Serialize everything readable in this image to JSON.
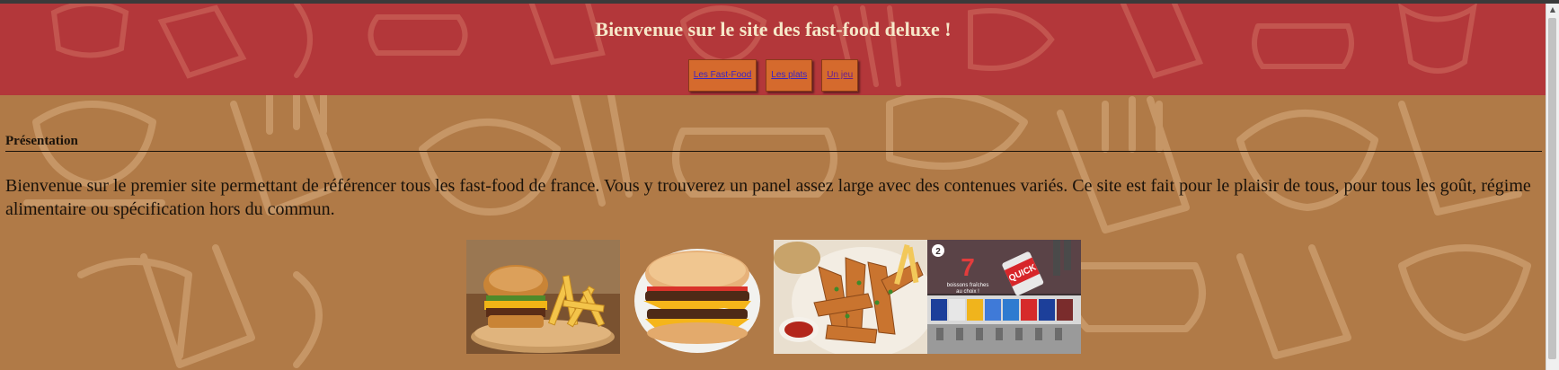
{
  "header": {
    "title": "Bienvenue sur le site des fast-food deluxe !",
    "nav": [
      {
        "label": "Les Fast-Food"
      },
      {
        "label": "Les plats"
      },
      {
        "label": "Un jeu"
      }
    ]
  },
  "main": {
    "section_title": "Présentation",
    "intro": "Bienvenue sur le premier site permettant de référencer tous les fast-food de france. Vous y trouverez un panel assez large avec des contenues variés. Ce site est fait pour le plaisir de tous, pour tous les goût, régime alimentaire ou spécification hors du commun.",
    "images": [
      {
        "name": "burger-and-fries-photo"
      },
      {
        "name": "double-cheeseburger-photo"
      },
      {
        "name": "potato-wedges-photo"
      },
      {
        "name": "soda-fountain-photo",
        "badge": "2",
        "big_number": "7",
        "caption_line1": "boissons fraîches",
        "caption_line2": "au choix !",
        "brand": "QUICK"
      }
    ]
  },
  "colors": {
    "header_bg": "#b3373a",
    "page_bg": "#b07a47",
    "title_text": "#f6e7c8",
    "nav_button": "#d56a2d",
    "link": "#3a24c4",
    "visited_link": "#6a1f8e"
  }
}
